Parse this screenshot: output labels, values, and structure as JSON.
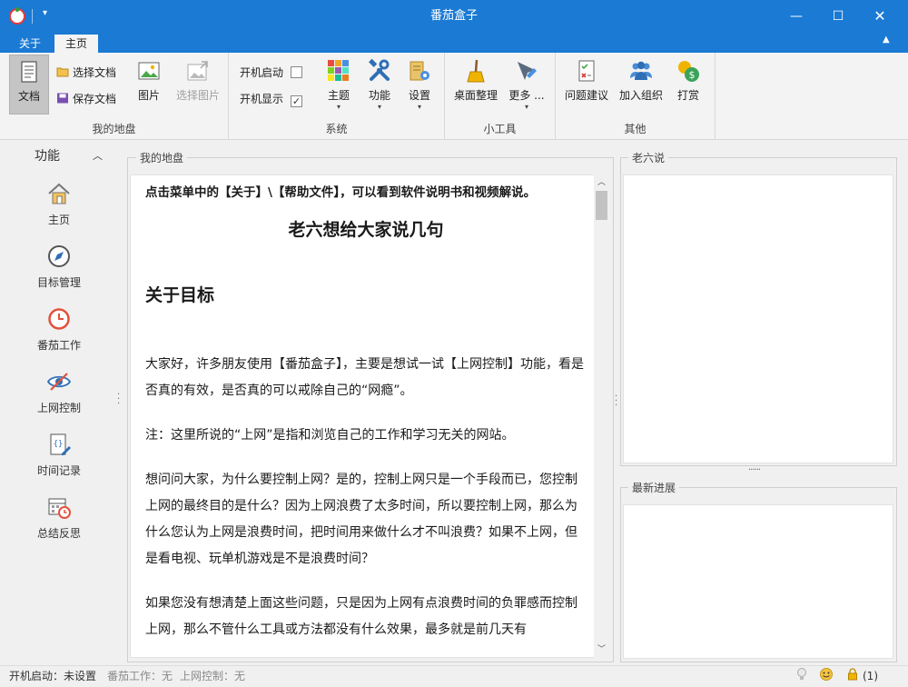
{
  "window": {
    "title": "番茄盒子",
    "minimize": "—",
    "maximize": "☐",
    "close": "✕",
    "quick_access": "▾"
  },
  "ribbon_tabs": [
    {
      "label": "关于"
    },
    {
      "label": "主页"
    }
  ],
  "ribbon": {
    "groups": {
      "my_site": {
        "label": "我的地盘",
        "doc_button": "文档",
        "select_doc": "选择文档",
        "save_doc": "保存文档",
        "picture": "图片",
        "select_picture": "选择图片"
      },
      "system": {
        "label": "系统",
        "auto_start": "开机启动",
        "auto_start_checked": false,
        "auto_show": "开机显示",
        "auto_show_checked": true,
        "theme": "主题",
        "function": "功能",
        "settings": "设置"
      },
      "tools": {
        "label": "小工具",
        "desktop_tidy": "桌面整理",
        "more": "更多 ..."
      },
      "other": {
        "label": "其他",
        "feedback": "问题建议",
        "join_group": "加入组织",
        "donate": "打赏"
      }
    }
  },
  "leftnav": {
    "title": "功能",
    "items": [
      {
        "label": "主页",
        "icon": "home-icon"
      },
      {
        "label": "目标管理",
        "icon": "compass-icon"
      },
      {
        "label": "番茄工作",
        "icon": "clock-icon"
      },
      {
        "label": "上网控制",
        "icon": "eye-slash-icon"
      },
      {
        "label": "时间记录",
        "icon": "log-edit-icon"
      },
      {
        "label": "总结反思",
        "icon": "calendar-clock-icon"
      }
    ]
  },
  "main_panel": {
    "title": "我的地盘",
    "doc": {
      "top_note": "点击菜单中的【关于】\\【帮助文件】，可以看到软件说明书和视频解说。",
      "heading1": "老六想给大家说几句",
      "heading2": "关于目标",
      "p1": "大家好，许多朋友使用【番茄盒子】，主要是想试一试【上网控制】功能，看是否真的有效，是否真的可以戒除自己的“网瘾”。",
      "p2": "注：这里所说的“上网”是指和浏览自己的工作和学习无关的网站。",
      "p3": "想问问大家，为什么要控制上网？是的，控制上网只是一个手段而已，您控制上网的最终目的是什么？因为上网浪费了太多时间，所以要控制上网，那么为什么您认为上网是浪费时间，把时间用来做什么才不叫浪费？如果不上网，但是看电视、玩单机游戏是不是浪费时间？",
      "p4": "如果您没有想清楚上面这些问题，只是因为上网有点浪费时间的负罪感而控制上网，那么不管什么工具或方法都没有什么效果，最多就是前几天有"
    }
  },
  "right_panels": {
    "top_title": "老六说",
    "bottom_title": "最新进展",
    "splitter": "......"
  },
  "statusbar": {
    "auto_start": "开机启动：未设置",
    "tomato_work": "番茄工作：无",
    "net_control": "上网控制：无",
    "lock_count": "(1)"
  },
  "colors": {
    "accent": "#1a7ad4",
    "ribbon_bg": "#f3f3f3"
  }
}
